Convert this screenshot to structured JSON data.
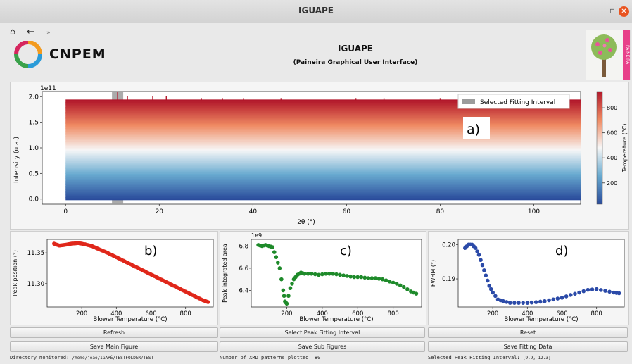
{
  "window": {
    "title": "IGUAPE",
    "min": "–",
    "max": "▫",
    "close": "✕"
  },
  "nav": {
    "home": "⌂",
    "back": "←",
    "more": "»"
  },
  "brand": {
    "logo_text": "CNPEM",
    "side_tag": "PAINEIRA"
  },
  "header": {
    "title": "IGUAPE",
    "subtitle": "(Paineira Graphical User Interface)"
  },
  "main_plot": {
    "offset_text": "1e11",
    "ylabel": "Intensity (u.a.)",
    "xlabel": "2θ (°)",
    "x_ticks": [
      "0",
      "20",
      "40",
      "60",
      "80",
      "100"
    ],
    "y_ticks": [
      "0.0",
      "0.5",
      "1.0",
      "1.5",
      "2.0"
    ],
    "legend_label": "Selected Fitting Interval",
    "panel_label": "a)",
    "colorbar_label": "Temperature (°C)",
    "colorbar_ticks": [
      "200",
      "400",
      "600",
      "800"
    ]
  },
  "chart_data": [
    {
      "type": "line",
      "ylabel": "Intensity (u.a.)",
      "xlabel": "2θ (°)",
      "xlim": [
        -5,
        110
      ],
      "ylim": [
        -10000000000.0,
        210000000000.0
      ],
      "temperature_range": [
        30,
        930
      ],
      "n_patterns": 80,
      "selected_interval": [
        9.9,
        12.3
      ],
      "pattern_extent": [
        0,
        110
      ],
      "pattern_base_offset_max": 193000000000.0,
      "peaks_2theta": [
        11.1,
        13.2,
        18.6,
        21.5,
        29.0,
        33.5,
        38.0,
        46.0,
        62.0,
        68.0,
        80.0,
        95.0
      ]
    },
    {
      "type": "scatter",
      "panel": "b)",
      "xlabel": "Blower Temperature (°C)",
      "ylabel": "Peak position (°)",
      "x_ticks": [
        "200",
        "400",
        "600",
        "800"
      ],
      "y_ticks": [
        "11.30",
        "11.35"
      ],
      "xlim": [
        0,
        960
      ],
      "ylim": [
        11.262,
        11.372
      ],
      "x": [
        40,
        70,
        100,
        140,
        180,
        220,
        260,
        300,
        350,
        400,
        450,
        500,
        550,
        600,
        650,
        700,
        750,
        800,
        850,
        900,
        930
      ],
      "y": [
        11.365,
        11.362,
        11.363,
        11.365,
        11.366,
        11.364,
        11.361,
        11.356,
        11.35,
        11.343,
        11.336,
        11.329,
        11.322,
        11.315,
        11.308,
        11.301,
        11.294,
        11.287,
        11.28,
        11.273,
        11.27
      ]
    },
    {
      "type": "scatter",
      "panel": "c)",
      "offset_text": "1e9",
      "xlabel": "Blower Temperature (°C)",
      "ylabel": "Peak integrated area",
      "x_ticks": [
        "200",
        "400",
        "600",
        "800"
      ],
      "y_ticks": [
        "6.4",
        "6.6",
        "6.8"
      ],
      "xlim": [
        0,
        960
      ],
      "ylim": [
        6.25,
        6.86
      ],
      "x": [
        40,
        60,
        80,
        100,
        120,
        140,
        160,
        180,
        190,
        200,
        220,
        240,
        260,
        280,
        300,
        340,
        380,
        420,
        460,
        500,
        540,
        580,
        620,
        660,
        700,
        740,
        780,
        820,
        860,
        900,
        930
      ],
      "y": [
        6.81,
        6.8,
        6.81,
        6.8,
        6.79,
        6.7,
        6.6,
        6.4,
        6.3,
        6.28,
        6.42,
        6.5,
        6.54,
        6.56,
        6.55,
        6.55,
        6.54,
        6.55,
        6.55,
        6.54,
        6.53,
        6.52,
        6.52,
        6.51,
        6.51,
        6.5,
        6.48,
        6.46,
        6.43,
        6.39,
        6.37
      ]
    },
    {
      "type": "scatter",
      "panel": "d)",
      "xlabel": "Blower Temperature (°C)",
      "ylabel": "FWHM (°)",
      "x_ticks": [
        "200",
        "400",
        "600",
        "800"
      ],
      "y_ticks": [
        "0.19",
        "0.20"
      ],
      "xlim": [
        0,
        960
      ],
      "ylim": [
        0.1818,
        0.2015
      ],
      "x": [
        40,
        60,
        80,
        100,
        120,
        140,
        160,
        180,
        200,
        230,
        260,
        300,
        350,
        400,
        450,
        500,
        550,
        600,
        650,
        700,
        750,
        800,
        850,
        900,
        930
      ],
      "y": [
        0.199,
        0.2,
        0.2,
        0.199,
        0.197,
        0.194,
        0.191,
        0.188,
        0.186,
        0.184,
        0.1835,
        0.183,
        0.183,
        0.183,
        0.1832,
        0.1835,
        0.184,
        0.1845,
        0.1853,
        0.186,
        0.1868,
        0.187,
        0.1865,
        0.186,
        0.1858
      ]
    }
  ],
  "buttons": {
    "refresh": "Refresh",
    "select_interval": "Select Peak Fitting Interval",
    "reset": "Reset",
    "save_main": "Save Main Figure",
    "save_sub": "Save Sub Figures",
    "save_fitting": "Save Fitting Data"
  },
  "status": {
    "dir_label": "Directory monitored:",
    "dir_value": "/home/joao/IGAPÉ/TESTFOLDER/TEST",
    "count_label": "Number of XRD patterns plotted:",
    "count_value": "80",
    "interval_label": "Selected Peak Fitting Interval:",
    "interval_value": "[9.9, 12.3]"
  },
  "colors": {
    "hot": "#b2182b",
    "cold": "#2166ac",
    "sub_b": "#e0271a",
    "sub_c": "#1e8a2a",
    "sub_d": "#2b4aa8",
    "selected_band": "#9c9c9c"
  }
}
